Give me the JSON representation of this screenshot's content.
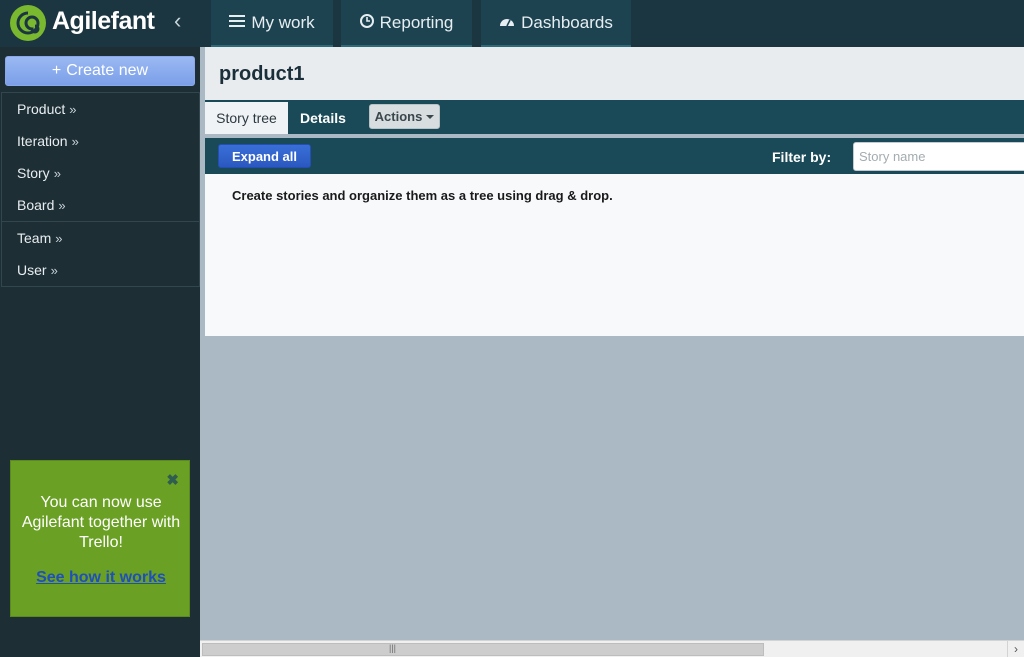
{
  "app": {
    "name": "Agilefant",
    "collapse_icon": "chevron-left-icon"
  },
  "nav": {
    "tabs": [
      {
        "label": "My work",
        "icon": "list-icon"
      },
      {
        "label": "Reporting",
        "icon": "clock-icon"
      },
      {
        "label": "Dashboards",
        "icon": "dashboard-icon"
      }
    ]
  },
  "sidebar": {
    "create_label": "Create new",
    "create_menu": [
      "Product",
      "Iteration",
      "Story",
      "Board"
    ],
    "admin_menu": [
      "Team",
      "User"
    ],
    "arrow": "»"
  },
  "promo": {
    "text": "You can now use Agilefant together with Trello!",
    "link": "See how it works",
    "close_icon": "close-icon",
    "bg_color": "#6aa124"
  },
  "page": {
    "title": "product1"
  },
  "tabs": {
    "story_tree": "Story tree",
    "details": "Details",
    "actions": "Actions"
  },
  "toolbar": {
    "expand_all": "Expand all",
    "filter_label": "Filter by:",
    "filter_placeholder": "Story name",
    "filter_value": ""
  },
  "content": {
    "message": "Create stories and organize them as a tree using drag & drop."
  },
  "colors": {
    "accent": "#1a4a58",
    "brand_green": "#7ab82f",
    "button_blue": "#2a58c0"
  }
}
